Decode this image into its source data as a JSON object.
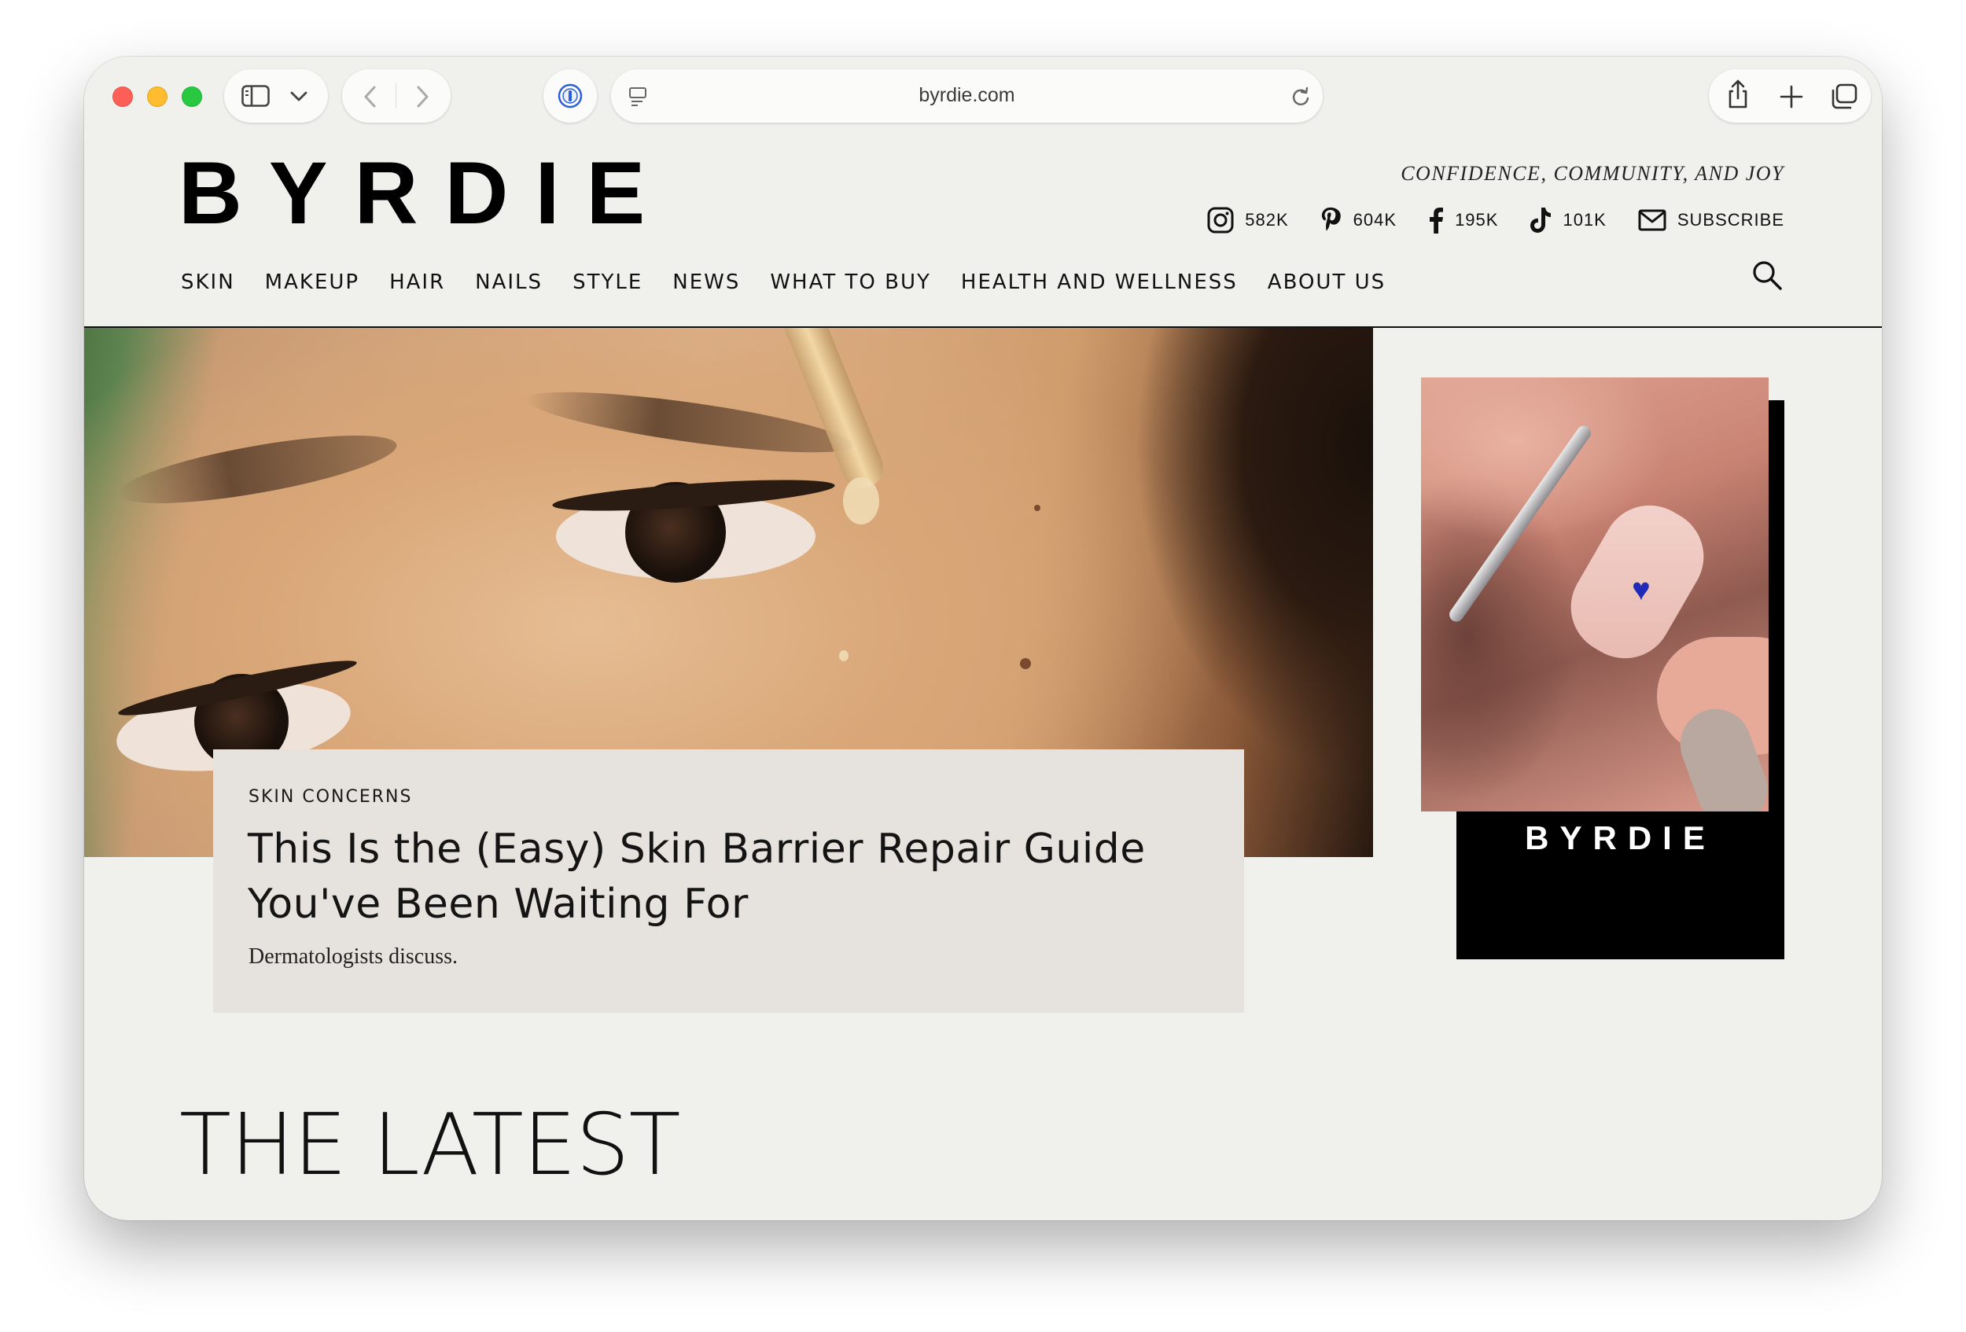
{
  "browser": {
    "url": "byrdie.com"
  },
  "site": {
    "logo": "BYRDIE",
    "tagline": "CONFIDENCE, COMMUNITY, AND JOY",
    "socials": [
      {
        "icon": "instagram-icon",
        "count": "582K"
      },
      {
        "icon": "pinterest-icon",
        "count": "604K"
      },
      {
        "icon": "facebook-icon",
        "count": "195K"
      },
      {
        "icon": "tiktok-icon",
        "count": "101K"
      },
      {
        "icon": "mail-icon",
        "count": "SUBSCRIBE"
      }
    ],
    "nav": [
      "SKIN",
      "MAKEUP",
      "HAIR",
      "NAILS",
      "STYLE",
      "NEWS",
      "WHAT TO BUY",
      "HEALTH AND WELLNESS",
      "ABOUT US"
    ]
  },
  "feature": {
    "kicker": "SKIN CONCERNS",
    "headline": "This Is the (Easy) Skin Barrier Repair Guide You've Been Waiting For",
    "subhead": "Dermatologists discuss."
  },
  "promo": {
    "logo": "BYRDIE"
  },
  "latest": {
    "title": "THE LATEST"
  }
}
